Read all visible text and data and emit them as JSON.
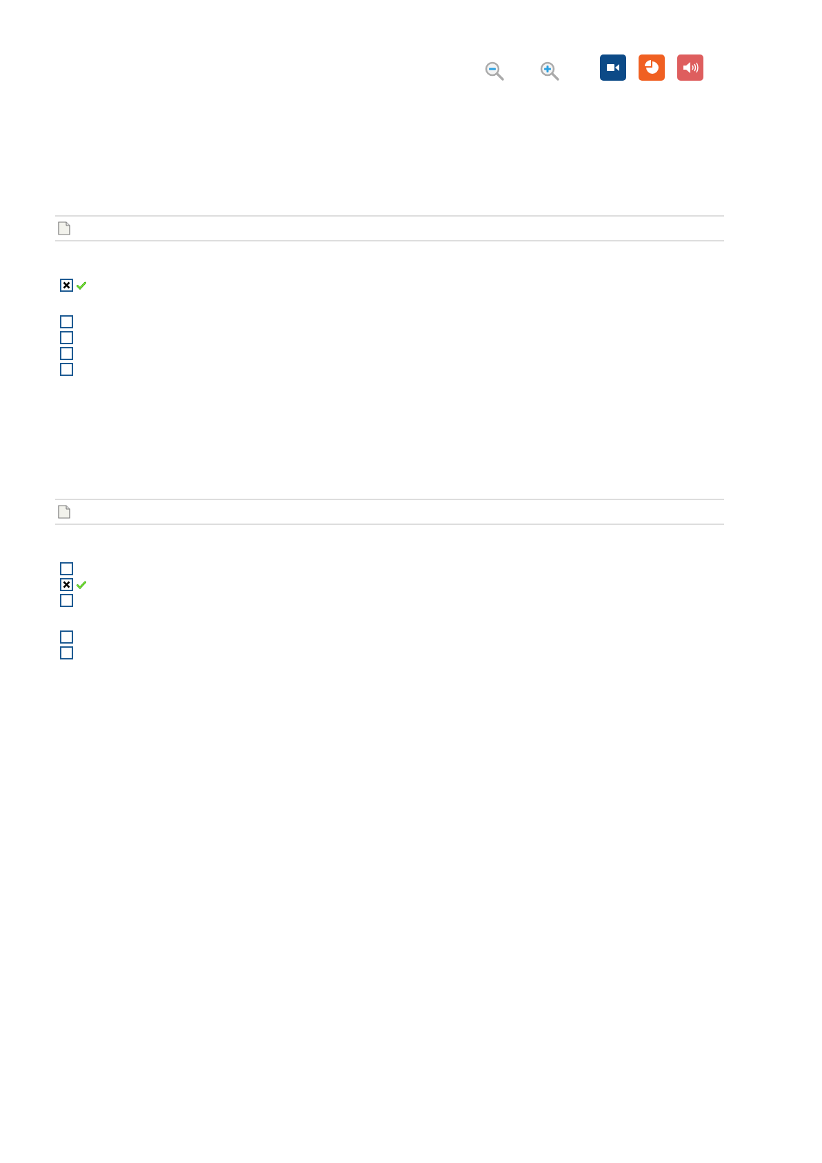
{
  "toolbar": [
    {
      "kind": "zoom-out"
    },
    {
      "kind": "zoom-in"
    },
    {
      "kind": "video"
    },
    {
      "kind": "chart"
    },
    {
      "kind": "audio"
    }
  ],
  "questions": [
    {
      "groups": [
        [
          {
            "checked": true,
            "correct": true
          }
        ],
        [
          {
            "checked": false,
            "correct": false
          },
          {
            "checked": false,
            "correct": false
          },
          {
            "checked": false,
            "correct": false
          },
          {
            "checked": false,
            "correct": false
          }
        ]
      ]
    },
    {
      "groups": [
        [
          {
            "checked": false,
            "correct": false
          },
          {
            "checked": true,
            "correct": true
          },
          {
            "checked": false,
            "correct": false
          }
        ],
        [
          {
            "checked": false,
            "correct": false
          },
          {
            "checked": false,
            "correct": false
          }
        ]
      ]
    }
  ]
}
